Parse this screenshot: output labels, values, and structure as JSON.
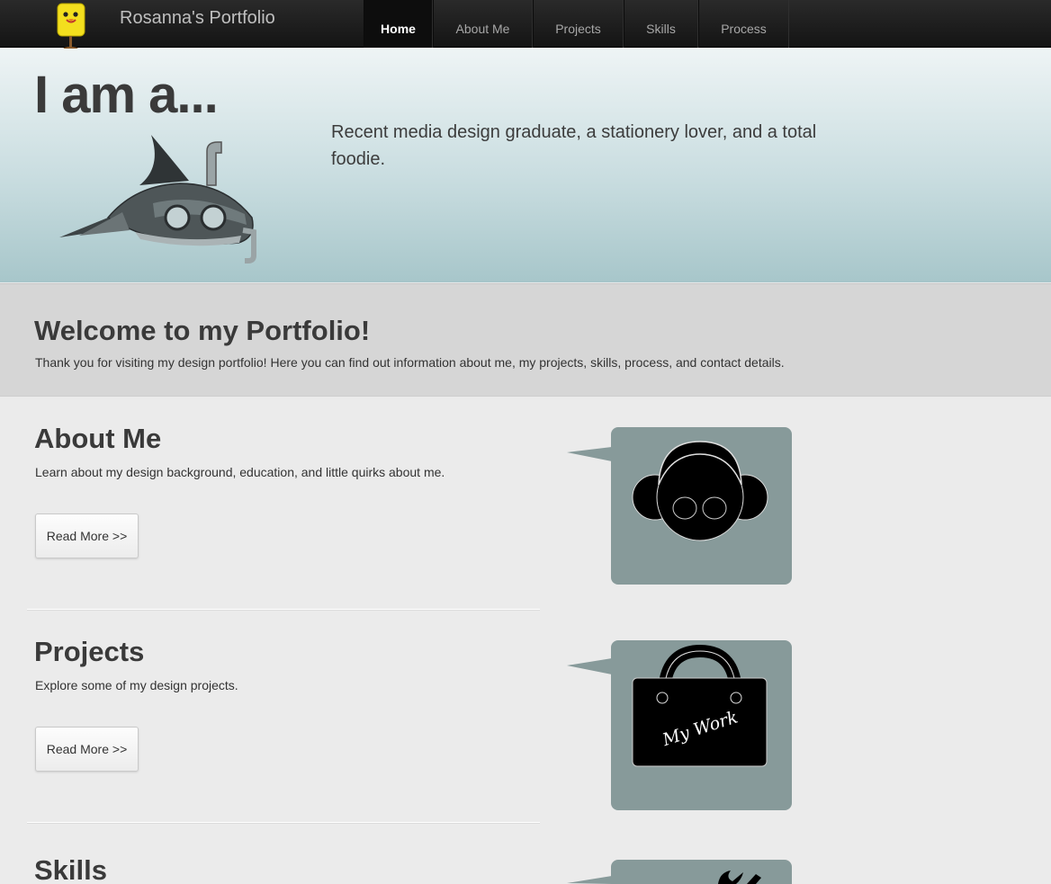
{
  "nav": {
    "brand": "Rosanna's Portfolio",
    "items": [
      {
        "label": "Home",
        "active": true
      },
      {
        "label": "About Me",
        "active": false
      },
      {
        "label": "Projects",
        "active": false
      },
      {
        "label": "Skills",
        "active": false
      },
      {
        "label": "Process",
        "active": false
      }
    ]
  },
  "hero": {
    "title": "I am a...",
    "text": "Recent media design graduate, a stationery lover, and a total foodie."
  },
  "welcome": {
    "title": "Welcome to my Portfolio!",
    "text": "Thank you for visiting my design portfolio! Here you can find out information about me, my projects, skills, process, and contact details."
  },
  "sections": [
    {
      "title": "About Me",
      "text": "Learn about my design background, education, and little quirks about me.",
      "button": "Read More >>"
    },
    {
      "title": "Projects",
      "text": "Explore some of my design projects.",
      "button": "Read More >>",
      "sign_text": "My Work"
    },
    {
      "title": "Skills"
    }
  ],
  "colors": {
    "nav_bg": "#1c1c1c",
    "hero_top": "#eef4f5",
    "hero_bottom": "#a7c6ca",
    "bubble": "#879a9a",
    "heading": "#3a3a3a"
  }
}
